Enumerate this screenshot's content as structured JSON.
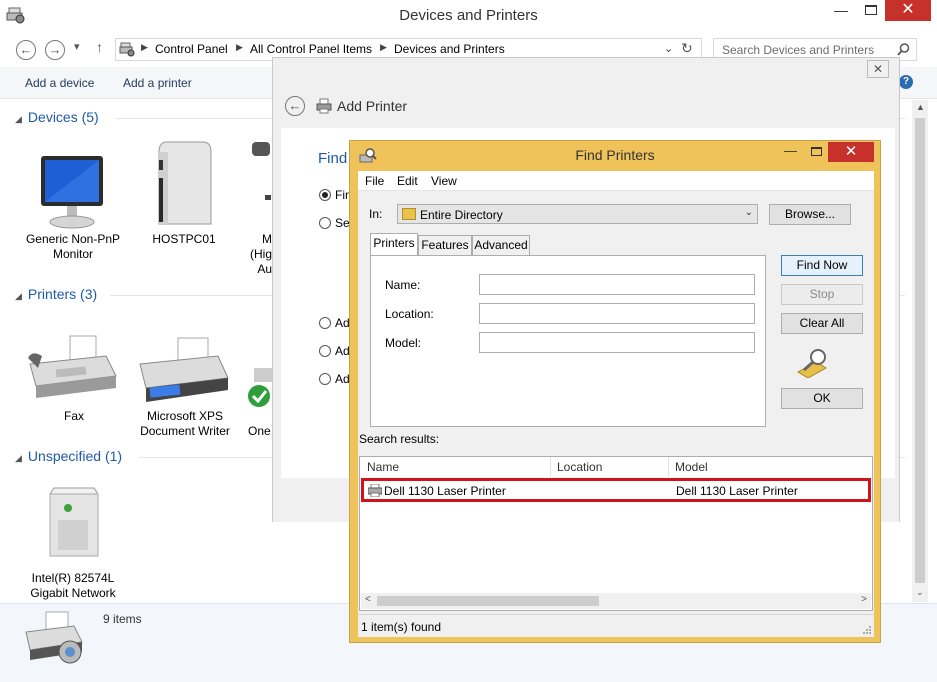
{
  "window": {
    "title": "Devices and Printers",
    "minimize": "—",
    "close": "✕"
  },
  "nav": {
    "back": "←",
    "forward": "→",
    "up": "↑",
    "breadcrumbs": [
      "Control Panel",
      "All Control Panel Items",
      "Devices and Printers"
    ],
    "search_placeholder": "Search Devices and Printers"
  },
  "commands": {
    "add_device": "Add a device",
    "add_printer": "Add a printer"
  },
  "groups": {
    "devices": {
      "header": "Devices (5)",
      "items": [
        "Generic Non-PnP Monitor",
        "HOSTPC01",
        "M (Hig Au"
      ]
    },
    "printers": {
      "header": "Printers (3)",
      "items": [
        "Fax",
        "Microsoft XPS Document Writer",
        "One"
      ]
    },
    "unspecified": {
      "header": "Unspecified (1)",
      "items": [
        "Intel(R) 82574L Gigabit Network"
      ]
    }
  },
  "device_labels": {
    "monitor_l1": "Generic Non-PnP",
    "monitor_l2": "Monitor",
    "hostpc": "HOSTPC01",
    "m_l1": "M",
    "m_l2": "(Hig",
    "m_l3": "Au",
    "fax": "Fax",
    "xps_l1": "Microsoft XPS",
    "xps_l2": "Document Writer",
    "one": "One",
    "intel_l1": "Intel(R) 82574L",
    "intel_l2": "Gigabit Network"
  },
  "status": {
    "items_count": "9 items"
  },
  "add_printer": {
    "title": "Add Printer",
    "find_text": "Find",
    "opt1": "Fin",
    "opt2": "Sel",
    "opt3": "Ad",
    "opt4": "Ad",
    "opt5": "Ad"
  },
  "find_printers": {
    "title": "Find Printers",
    "menu": [
      "File",
      "Edit",
      "View"
    ],
    "in_label": "In:",
    "in_value": "Entire Directory",
    "browse": "Browse...",
    "tabs": [
      "Printers",
      "Features",
      "Advanced"
    ],
    "fields": {
      "name": "Name:",
      "location": "Location:",
      "model": "Model:"
    },
    "buttons": {
      "find_now": "Find Now",
      "stop": "Stop",
      "clear_all": "Clear All",
      "ok": "OK"
    },
    "search_results_label": "Search results:",
    "columns": [
      "Name",
      "Location",
      "Model"
    ],
    "results": [
      {
        "name": "Dell 1130 Laser Printer",
        "location": "",
        "model": "Dell 1130 Laser Printer"
      }
    ],
    "status": "1 item(s) found"
  },
  "colors": {
    "accent": "#1e5aa8",
    "highlight_border": "#d1121a",
    "dialog_frame": "#f0c35a",
    "close_red": "#c7312c"
  }
}
